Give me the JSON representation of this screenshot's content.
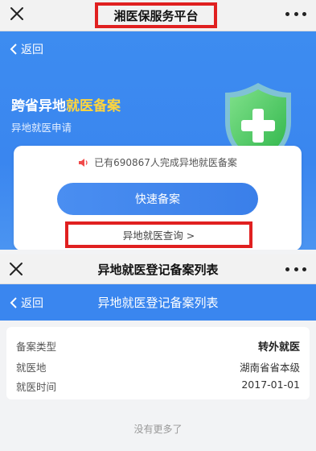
{
  "top_nav": {
    "title": "湘医保服务平台",
    "close_icon": "close-icon",
    "more_icon": "more-dots-icon"
  },
  "hero": {
    "back_label": "返回",
    "heading_prefix": "跨省异地",
    "heading_highlight": "就医备案",
    "subheading": "异地就医申请",
    "highlight_color": "#ffd53d",
    "shield_icon": "medical-shield-icon"
  },
  "card": {
    "notice": "已有690867人完成异地就医备案",
    "speaker_icon": "speaker-icon",
    "quick_button": "快速备案",
    "query_link": "异地就医查询 >"
  },
  "second_nav": {
    "title": "异地就医登记备案列表"
  },
  "blue_bar": {
    "back_label": "返回",
    "title": "异地就医登记备案列表"
  },
  "record": {
    "rows": [
      {
        "label": "备案类型",
        "value": "转外就医"
      },
      {
        "label": "就医地",
        "value": "湖南省省本级"
      },
      {
        "label": "就医时间",
        "value": "2017-01-01"
      }
    ]
  },
  "footer": {
    "no_more": "没有更多了"
  },
  "colors": {
    "primary": "#3a86ef",
    "annotation_red": "#e02020"
  }
}
